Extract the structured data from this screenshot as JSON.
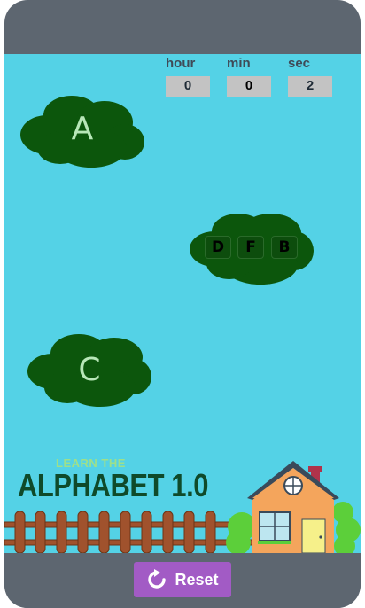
{
  "timer": {
    "hour_label": "hour",
    "min_label": "min",
    "sec_label": "sec",
    "hour_value": "0",
    "min_value": "0",
    "sec_value": "2"
  },
  "clouds": {
    "first_letter": "A",
    "second_letter": "C"
  },
  "tiles": [
    "D",
    "F",
    "B"
  ],
  "logo": {
    "small_text": "LEARN THE",
    "big_text": "ALPHABET 1.0"
  },
  "reset": {
    "label": "Reset",
    "icon": "refresh-icon"
  },
  "colors": {
    "sky": "#54d2e6",
    "cloud": "#0c560c",
    "frame": "#5d6670",
    "reset_button": "#a25bc5"
  }
}
